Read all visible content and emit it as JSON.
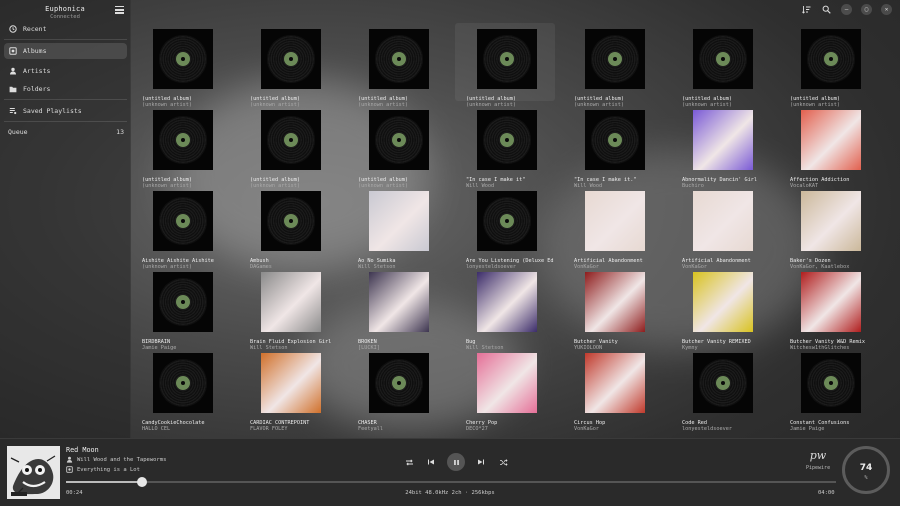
{
  "app": {
    "title": "Euphonica",
    "status": "Connected"
  },
  "sidebar": {
    "items": [
      {
        "label": "Recent",
        "icon": "clock-icon"
      },
      {
        "label": "Albums",
        "icon": "album-icon",
        "active": true
      },
      {
        "label": "Artists",
        "icon": "person-icon"
      },
      {
        "label": "Folders",
        "icon": "folder-icon"
      },
      {
        "label": "Saved Playlists",
        "icon": "playlist-icon"
      }
    ],
    "queue_label": "Queue",
    "queue_count": "13"
  },
  "topbar": {
    "icons": [
      "sort-icon",
      "search-icon",
      "minimize-icon",
      "maximize-icon",
      "close-icon"
    ]
  },
  "albums": [
    {
      "title": "(untitled album)",
      "artist": "(unknown artist)"
    },
    {
      "title": "(untitled album)",
      "artist": "(unknown artist)"
    },
    {
      "title": "(untitled album)",
      "artist": "(unknown artist)"
    },
    {
      "title": "(untitled album)",
      "artist": "(unknown artist)",
      "highlight": true
    },
    {
      "title": "(untitled album)",
      "artist": "(unknown artist)"
    },
    {
      "title": "(untitled album)",
      "artist": "(unknown artist)"
    },
    {
      "title": "(untitled album)",
      "artist": "(unknown artist)"
    },
    {
      "title": "(untitled album)",
      "artist": "(unknown artist)"
    },
    {
      "title": "(untitled album)",
      "artist": "(unknown artist)"
    },
    {
      "title": "(untitled album)",
      "artist": "(unknown artist)"
    },
    {
      "title": "\"In case I make it\"",
      "artist": "Will Wood"
    },
    {
      "title": "\"In case I make it.\"",
      "artist": "Will Wood"
    },
    {
      "title": "Abnormality Dancin' Girl",
      "artist": "Buchiro",
      "art": "#7a5ad6"
    },
    {
      "title": "Affection Addiction",
      "artist": "VocaloKAT",
      "art": "#e2604e"
    },
    {
      "title": "Aishite Aishite Aishite",
      "artist": "(unknown artist)"
    },
    {
      "title": "Ambush",
      "artist": "DAGames"
    },
    {
      "title": "Ao No Sumika",
      "artist": "Will Stetson",
      "art": "#c9c9d2"
    },
    {
      "title": "Are You Listening (Deluxe Editio…",
      "artist": "lonyesteldsoever"
    },
    {
      "title": "Artificial Abandonment",
      "artist": "VonKaGor",
      "art": "#e7d9d2"
    },
    {
      "title": "Artificial Abandonment",
      "artist": "VonKaGor",
      "art": "#e7d9d2"
    },
    {
      "title": "Baker's Dozen",
      "artist": "VonKaGor, Kaatlebox",
      "art": "#cbb89a"
    },
    {
      "title": "BIRDBRAIN",
      "artist": "Jamie Paige"
    },
    {
      "title": "Brain Fluid Explosion Girl",
      "artist": "Will Stetson",
      "art": "#8a8a8a"
    },
    {
      "title": "BROKEN",
      "artist": "[LUCKI]",
      "art": "#3d3550"
    },
    {
      "title": "Bug",
      "artist": "Will Stetson",
      "art": "#3b2c6a"
    },
    {
      "title": "Butcher Vanity",
      "artist": "YUKIOLOON",
      "art": "#8e1d1d"
    },
    {
      "title": "Butcher Vanity REMIXED",
      "artist": "Kymny",
      "art": "#d8c21f"
    },
    {
      "title": "Butcher Vanity W&D Remix",
      "artist": "Witchesw1thGlitches",
      "art": "#b01d1d"
    },
    {
      "title": "CandyCookieChocolate",
      "artist": "HALLO CEL"
    },
    {
      "title": "CARDIAC CONTREPOINT",
      "artist": "FLAVOR FOLEY",
      "art": "#d0702a"
    },
    {
      "title": "CHASER",
      "artist": "Feetyall"
    },
    {
      "title": "Cherry Pop",
      "artist": "DECO*27",
      "art": "#e56f97"
    },
    {
      "title": "Circus Hop",
      "artist": "VonKaGor",
      "art": "#c0392b"
    },
    {
      "title": "Code Red",
      "artist": "lonyesteldsoever"
    },
    {
      "title": "Constant Confusions",
      "artist": "Jamie Paige"
    }
  ],
  "player": {
    "title": "Red Moon",
    "artist": "Will Wood and the Tapeworms",
    "album": "Everything is a Lot",
    "time_current": "00:24",
    "time_total": "04:00",
    "format": "24bit 48.0kHz 2ch · 256kbps",
    "progress": 0.099,
    "output_logo": "pw",
    "output_name": "Pipewire",
    "volume": "74",
    "volume_unit": "%"
  }
}
